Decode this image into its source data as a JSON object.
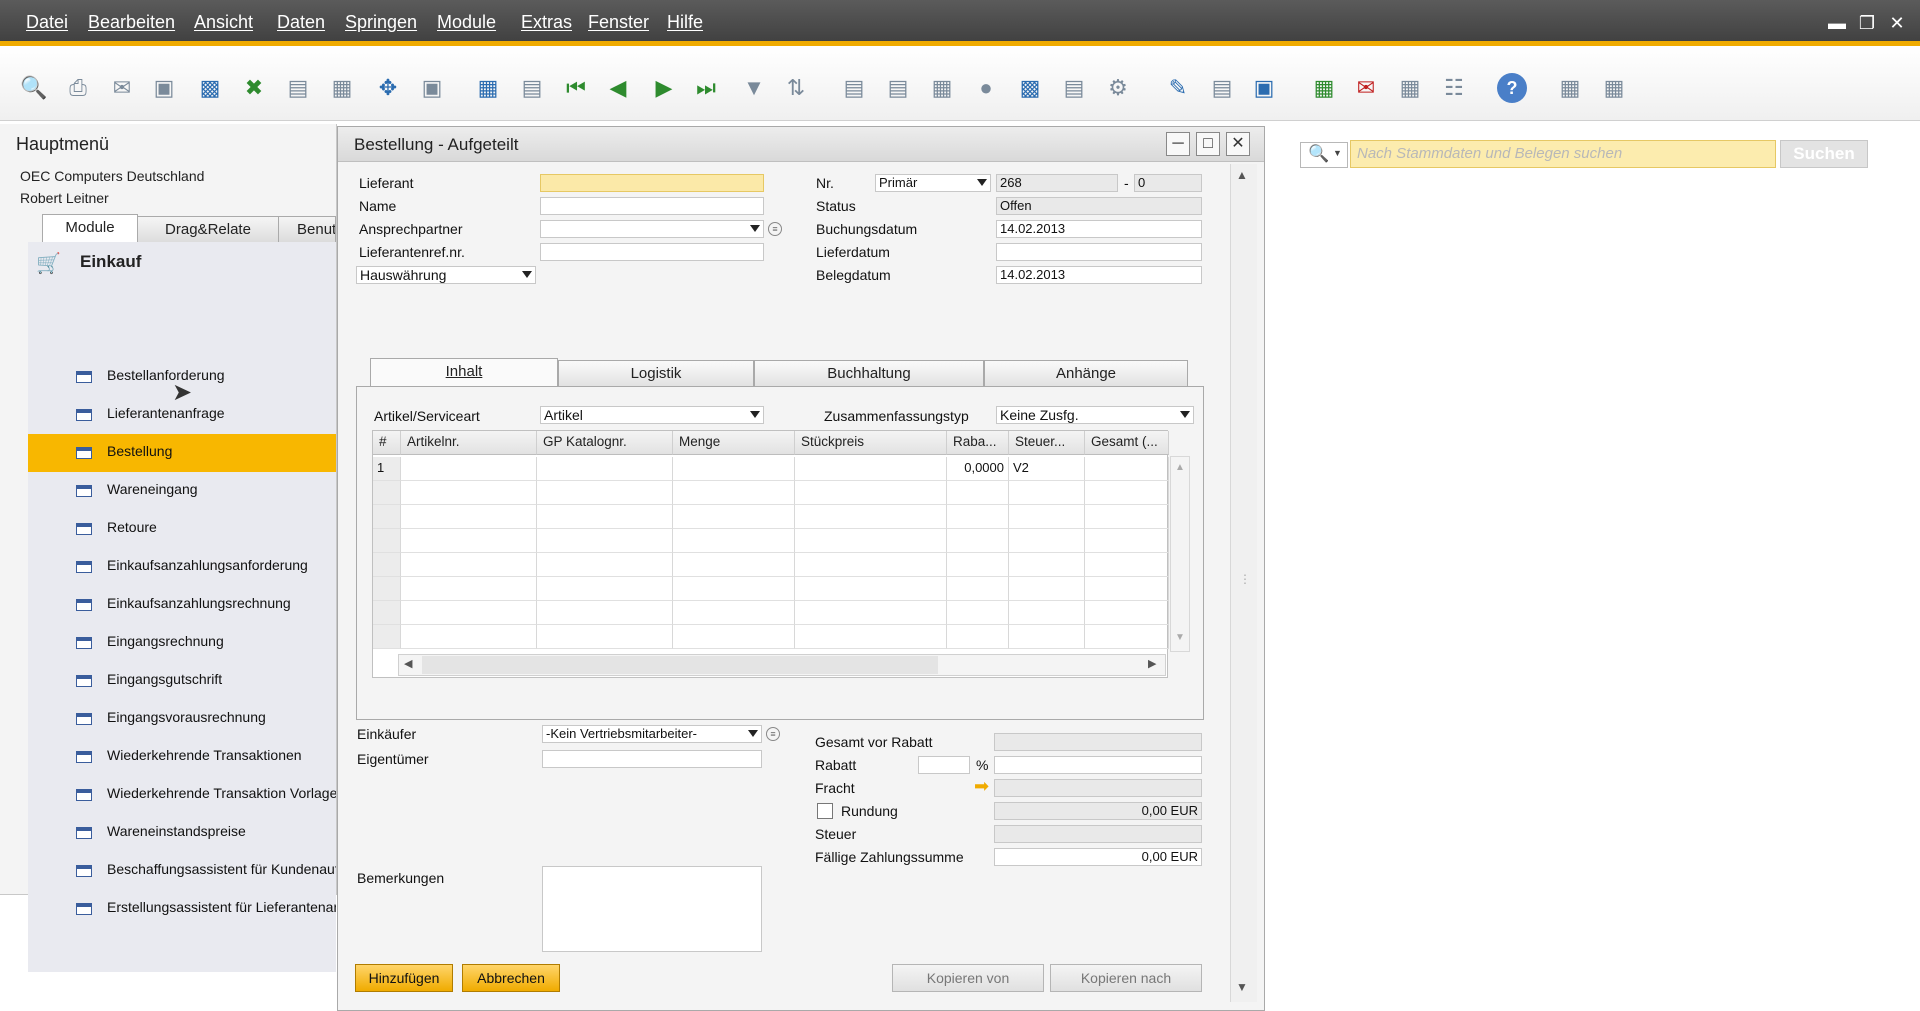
{
  "menubar": {
    "items": [
      "Datei",
      "Bearbeiten",
      "Ansicht",
      "Daten",
      "Springen",
      "Module",
      "Extras",
      "Fenster",
      "Hilfe"
    ]
  },
  "mainmenu": {
    "title": "Hauptmenü",
    "company": "OEC Computers Deutschland",
    "user": "Robert Leitner",
    "tabs": [
      "Module",
      "Drag&Relate",
      "Benut"
    ],
    "section": "Einkauf",
    "items": [
      "Bestellanforderung",
      "Lieferantenanfrage",
      "Bestellung",
      "Wareneingang",
      "Retoure",
      "Einkaufsanzahlungsanforderung",
      "Einkaufsanzahlungsrechnung",
      "Eingangsrechnung",
      "Eingangsgutschrift",
      "Eingangsvorausrechnung",
      "Wiederkehrende Transaktionen",
      "Wiederkehrende Transaktion Vorlagen",
      "Wareneinstandspreise",
      "Beschaffungsassistent für Kundenaufträge",
      "Erstellungsassistent für Lieferantenanfragen"
    ],
    "selected_index": 2
  },
  "dialog": {
    "title": "Bestellung - Aufgeteilt",
    "header_left": {
      "lieferant_label": "Lieferant",
      "name_label": "Name",
      "ansprechpartner_label": "Ansprechpartner",
      "lieferantenref_label": "Lieferantenref.nr.",
      "currency_value": "Hauswährung"
    },
    "header_right": {
      "nr_label": "Nr.",
      "series_value": "Primär",
      "nr_value": "268",
      "nr_dash": "-",
      "nr_sub": "0",
      "status_label": "Status",
      "status_value": "Offen",
      "buchungsdatum_label": "Buchungsdatum",
      "buchungsdatum_value": "14.02.2013",
      "lieferdatum_label": "Lieferdatum",
      "lieferdatum_value": "",
      "belegdatum_label": "Belegdatum",
      "belegdatum_value": "14.02.2013"
    },
    "tabs": [
      "Inhalt",
      "Logistik",
      "Buchhaltung",
      "Anhänge"
    ],
    "content": {
      "artikel_label": "Artikel/Serviceart",
      "artikel_value": "Artikel",
      "zusammen_label": "Zusammenfassungstyp",
      "zusammen_value": "Keine Zusfg.",
      "columns": [
        "#",
        "Artikelnr.",
        "GP Katalognr.",
        "Menge",
        "Stückpreis",
        "Raba...",
        "Steuer...",
        "Gesamt (..."
      ],
      "rows": [
        [
          "1",
          "",
          "",
          "",
          "",
          "0,0000",
          "V2",
          ""
        ]
      ]
    },
    "footer_left": {
      "einkaeufer_label": "Einkäufer",
      "einkaeufer_value": "-Kein Vertriebsmitarbeiter-",
      "eigentuemer_label": "Eigentümer",
      "bemerkungen_label": "Bemerkungen"
    },
    "footer_right": {
      "gesamt_vor_rabatt_label": "Gesamt vor Rabatt",
      "rabatt_label": "Rabatt",
      "percent": "%",
      "fracht_label": "Fracht",
      "rundung_label": "Rundung",
      "rundung_value": "0,00 EUR",
      "steuer_label": "Steuer",
      "faellig_label": "Fällige Zahlungssumme",
      "faellig_value": "0,00 EUR"
    },
    "buttons": {
      "add": "Hinzufügen",
      "cancel": "Abbrechen",
      "copy_from": "Kopieren von",
      "copy_to": "Kopieren nach"
    }
  },
  "search": {
    "placeholder": "Nach Stammdaten und Belegen suchen",
    "button": "Suchen"
  },
  "colors": {
    "accent": "#f0ab00",
    "selection": "#f8b700",
    "menubar": "#4a4a4a"
  }
}
